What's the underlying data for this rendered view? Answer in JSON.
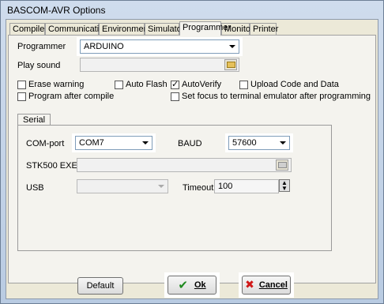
{
  "window": {
    "title": "BASCOM-AVR Options"
  },
  "tabs": [
    {
      "label": "Compiler"
    },
    {
      "label": "Communication"
    },
    {
      "label": "Environment"
    },
    {
      "label": "Simulator"
    },
    {
      "label": "Programmer"
    },
    {
      "label": "Monitor"
    },
    {
      "label": "Printer"
    }
  ],
  "programmer": {
    "label": "Programmer",
    "value": "ARDUINO",
    "play_sound_label": "Play sound",
    "options": {
      "erase_warning": {
        "label": "Erase warning",
        "checked": false
      },
      "auto_flash": {
        "label": "Auto Flash",
        "checked": false
      },
      "auto_verify": {
        "label": "AutoVerify",
        "checked": true
      },
      "upload_code": {
        "label": "Upload Code and Data",
        "checked": false
      },
      "program_after_compile": {
        "label": "Program after compile",
        "checked": false
      },
      "set_focus": {
        "label": "Set focus to terminal emulator after programming",
        "checked": false
      }
    }
  },
  "serial": {
    "tab_label": "Serial",
    "com_port_label": "COM-port",
    "com_port_value": "COM7",
    "baud_label": "BAUD",
    "baud_value": "57600",
    "stk_label": "STK500 EXE",
    "usb_label": "USB",
    "timeout_label": "Timeout",
    "timeout_value": "100"
  },
  "buttons": {
    "default": "Default",
    "ok": "Ok",
    "cancel": "Cancel"
  }
}
